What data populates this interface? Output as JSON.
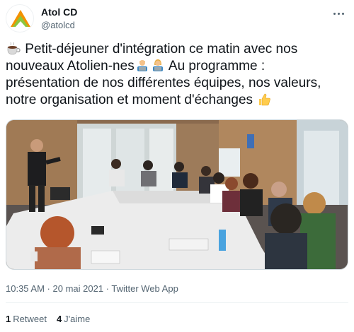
{
  "author": {
    "name": "Atol CD",
    "handle": "@atolcd"
  },
  "tweet": {
    "line1": "Petit-déjeuner d'intégration ce matin avec nos",
    "line2a": "nouveaux Atolien-nes",
    "line2b": " Au programme :",
    "line3": "présentation de nos différentes équipes, nos valeurs,",
    "line4": "notre organisation et moment d'échanges",
    "emojis": [
      "coffee-icon",
      "man-technologist-icon",
      "woman-technologist-icon",
      "thumbs-up-icon"
    ]
  },
  "meta": {
    "time": "10:35 AM",
    "separator1": " · ",
    "date": "20 mai 2021",
    "separator2": " · ",
    "app": "Twitter Web App"
  },
  "stats": {
    "retweets_count": "1",
    "retweets_label": "Retweet",
    "likes_count": "4",
    "likes_label": "J'aime"
  },
  "colors": {
    "text": "#0f1419",
    "secondary": "#536471",
    "border": "#cfd9de"
  }
}
